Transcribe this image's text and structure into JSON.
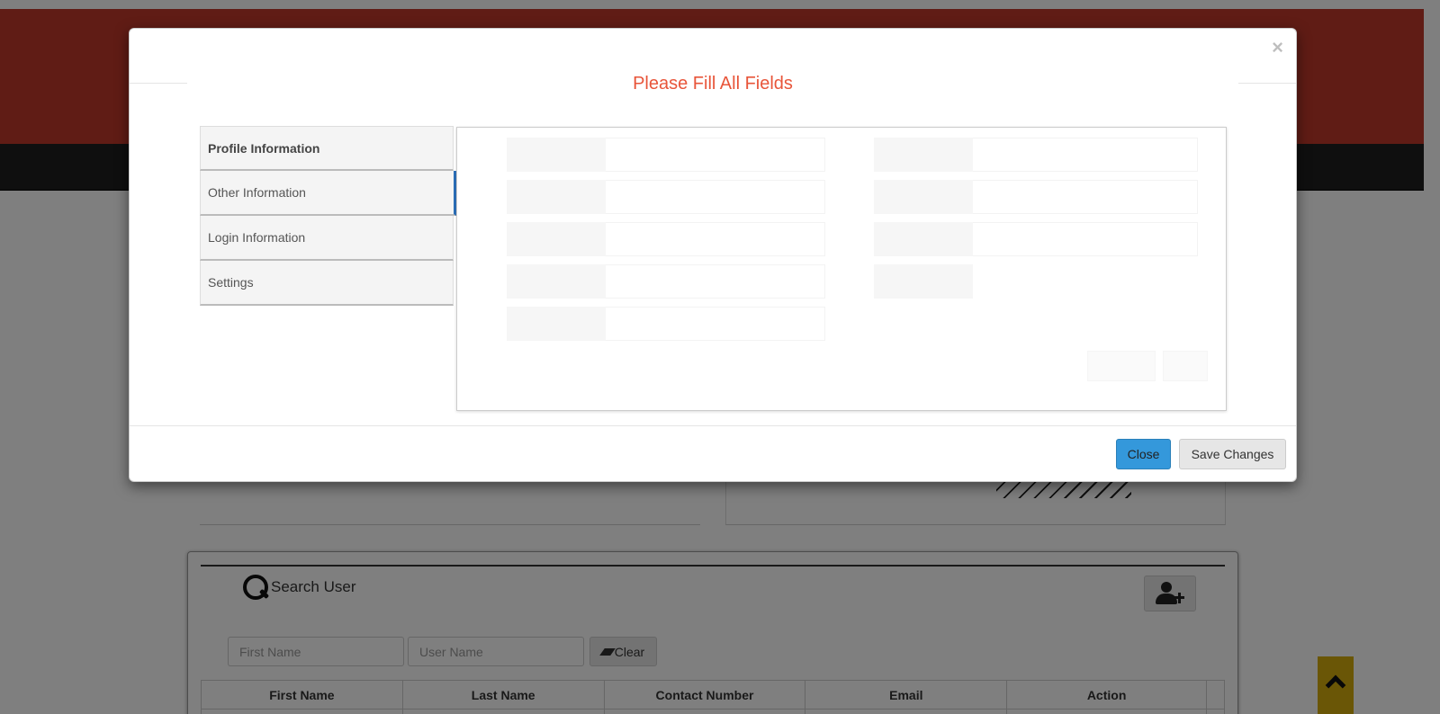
{
  "background": {
    "search_title": "Search User",
    "first_name_placeholder": "First Name",
    "user_name_placeholder": "User Name",
    "clear_label": "Clear",
    "table_headers": [
      "First Name",
      "Last Name",
      "Contact Number",
      "Email",
      "Action"
    ],
    "colors": {
      "header_red": "#c0392b",
      "nav_dark": "#1e1e1e",
      "scroll_top": "#d4ac0d"
    }
  },
  "modal": {
    "close_x": "×",
    "title": "Please Fill All Fields",
    "tabs": [
      {
        "label": "Profile Information"
      },
      {
        "label": "Other Information"
      },
      {
        "label": "Login Information"
      },
      {
        "label": "Settings"
      }
    ],
    "footer": {
      "close_label": "Close",
      "save_label": "Save Changes"
    },
    "colors": {
      "title": "#e8553a",
      "close_button": "#3498db",
      "tab_indicator": "#2c6fb8"
    }
  },
  "icons": {
    "search": "search-icon",
    "add_user": "add-user-icon",
    "eraser": "eraser-icon",
    "scroll_top": "chevron-up-icon"
  }
}
